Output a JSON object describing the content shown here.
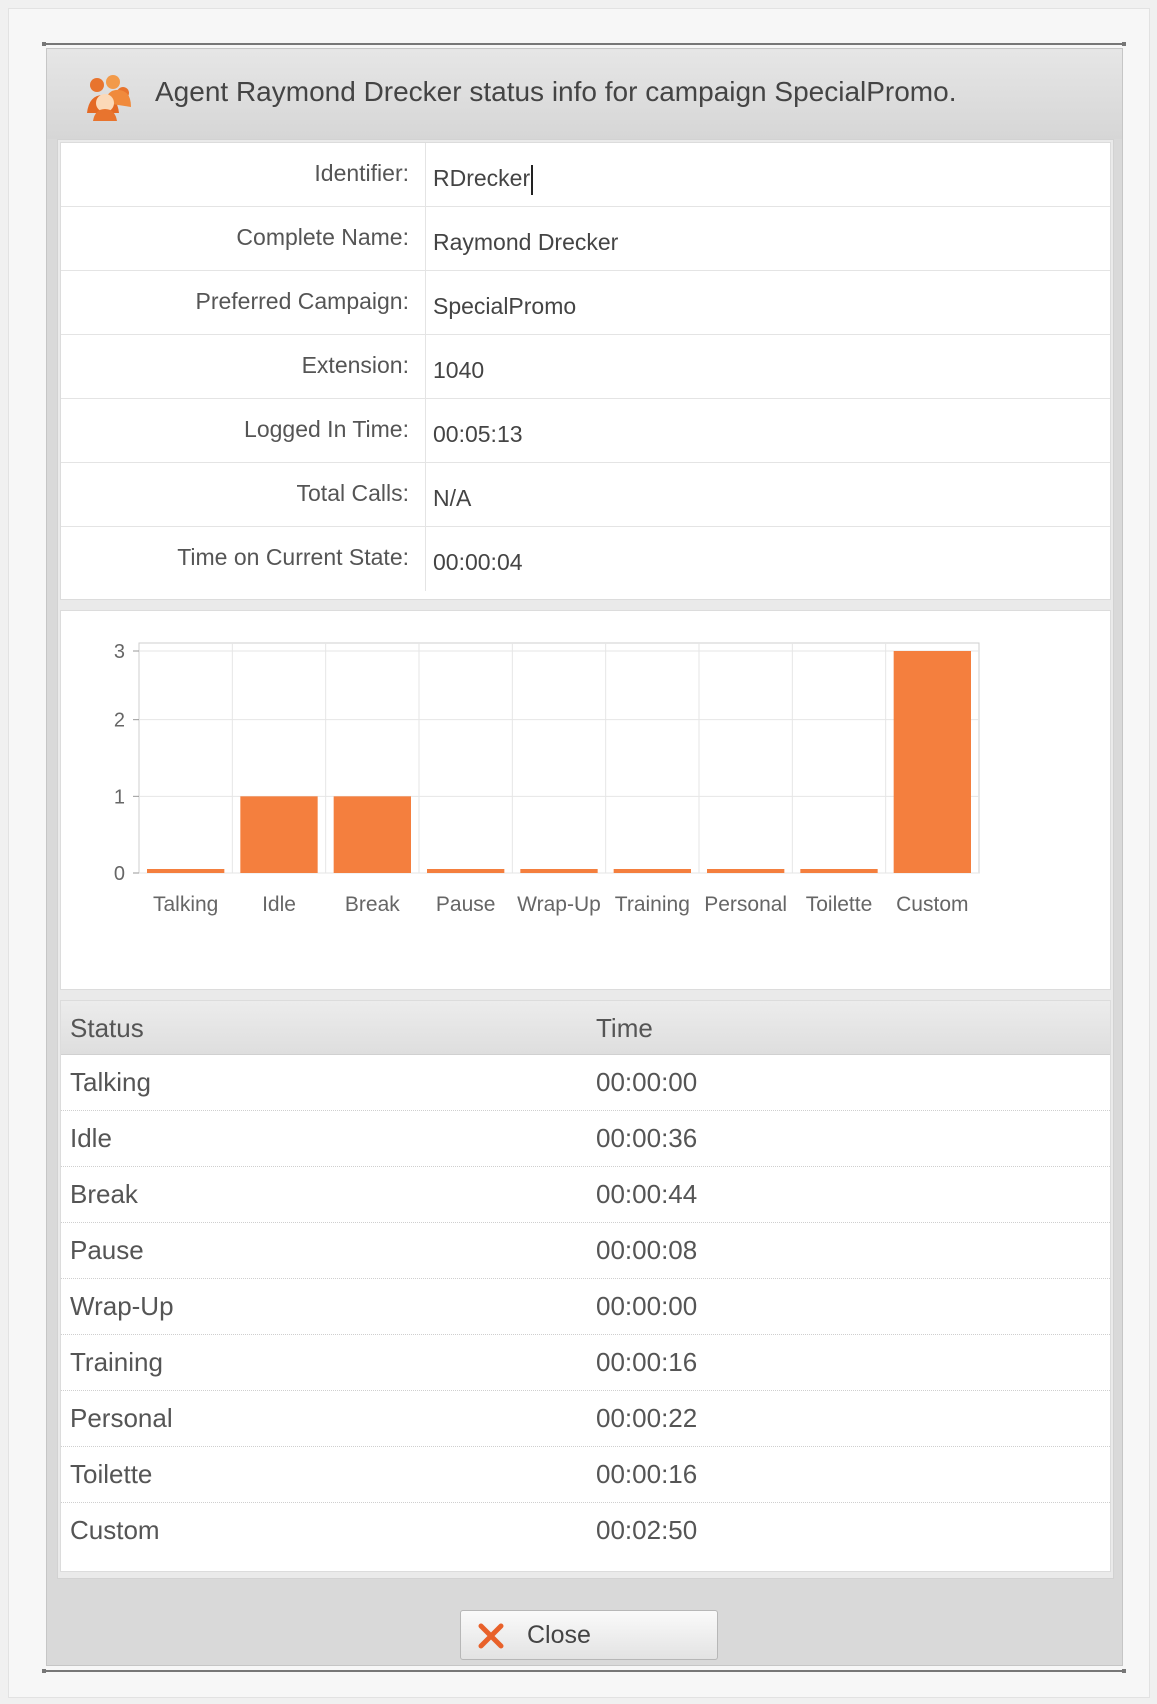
{
  "dialog": {
    "title": "Agent Raymond Drecker status info for campaign SpecialPromo.",
    "icon": "agents-group-icon",
    "close_label": "Close"
  },
  "info": {
    "rows": [
      {
        "label": "Identifier:",
        "value": "RDrecker"
      },
      {
        "label": "Complete Name:",
        "value": "Raymond Drecker"
      },
      {
        "label": "Preferred Campaign:",
        "value": "SpecialPromo"
      },
      {
        "label": "Extension:",
        "value": "1040"
      },
      {
        "label": "Logged In Time:",
        "value": "00:05:13"
      },
      {
        "label": "Total Calls:",
        "value": "N/A"
      },
      {
        "label": "Time on Current State:",
        "value": "00:00:04"
      }
    ]
  },
  "chart_data": {
    "type": "bar",
    "categories": [
      "Talking",
      "Idle",
      "Break",
      "Pause",
      "Wrap-Up",
      "Training",
      "Personal",
      "Toilette",
      "Custom"
    ],
    "values": [
      0,
      1,
      1,
      0,
      0,
      0,
      0,
      0,
      3
    ],
    "ylim": [
      0,
      3
    ],
    "yticks": [
      "0",
      "1",
      "2",
      "3"
    ],
    "grid": true,
    "bar_color": "#f47f3e"
  },
  "status_table": {
    "headers": {
      "status": "Status",
      "time": "Time"
    },
    "rows": [
      {
        "status": "Talking",
        "time": "00:00:00"
      },
      {
        "status": "Idle",
        "time": "00:00:36"
      },
      {
        "status": "Break",
        "time": "00:00:44"
      },
      {
        "status": "Pause",
        "time": "00:00:08"
      },
      {
        "status": "Wrap-Up",
        "time": "00:00:00"
      },
      {
        "status": "Training",
        "time": "00:00:16"
      },
      {
        "status": "Personal",
        "time": "00:00:22"
      },
      {
        "status": "Toilette",
        "time": "00:00:16"
      },
      {
        "status": "Custom",
        "time": "00:02:50"
      }
    ]
  }
}
